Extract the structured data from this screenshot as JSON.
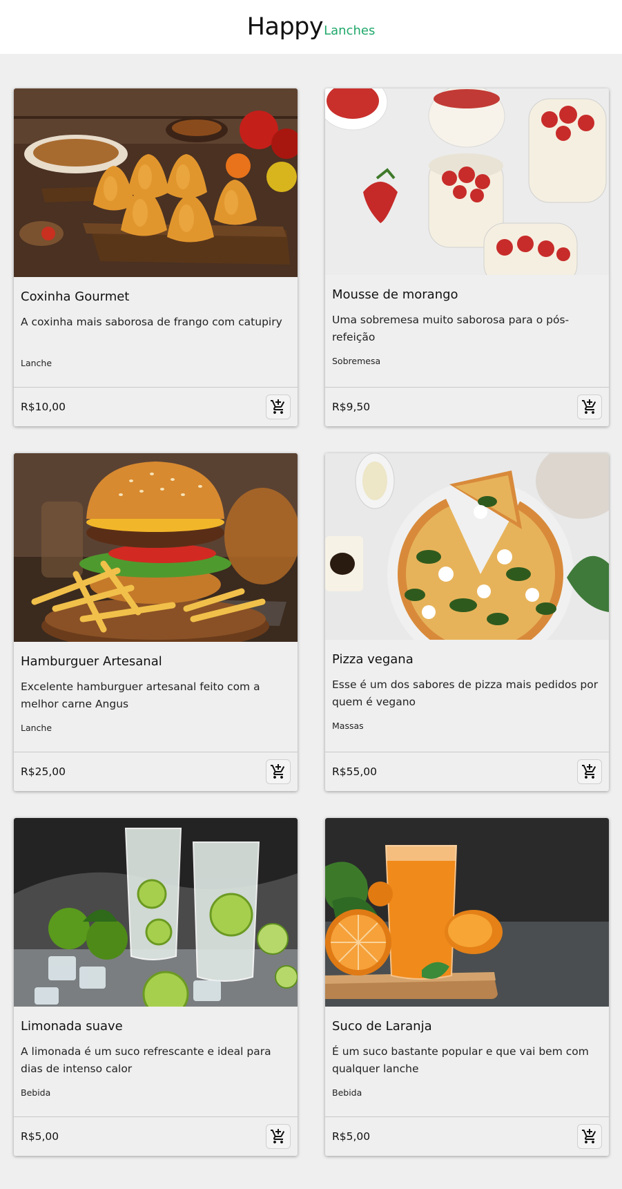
{
  "header": {
    "logo_main": "Happy",
    "logo_sub": "Lanches"
  },
  "colors": {
    "accent": "#1fa86a",
    "background": "#efefef",
    "header_bg": "#ffffff"
  },
  "products": [
    {
      "title": "Coxinha Gourmet",
      "description": "A coxinha mais saborosa de frango com catupiry",
      "category": "Lanche",
      "price": "R$10,00",
      "image": "coxinha-photo",
      "cart_icon": "add-to-cart-icon"
    },
    {
      "title": "Mousse de morango",
      "description": "Uma sobremesa muito saborosa para o pós-refeição",
      "category": "Sobremesa",
      "price": "R$9,50",
      "image": "mousse-photo",
      "cart_icon": "add-to-cart-icon"
    },
    {
      "title": "Hamburguer Artesanal",
      "description": "Excelente hamburguer artesanal feito com a melhor carne Angus",
      "category": "Lanche",
      "price": "R$25,00",
      "image": "burger-photo",
      "cart_icon": "add-to-cart-icon"
    },
    {
      "title": "Pizza vegana",
      "description": "Esse é um dos sabores de pizza mais pedidos por quem é vegano",
      "category": "Massas",
      "price": "R$55,00",
      "image": "pizza-photo",
      "cart_icon": "add-to-cart-icon"
    },
    {
      "title": "Limonada suave",
      "description": "A limonada é um suco refrescante e ideal para dias de intenso calor",
      "category": "Bebida",
      "price": "R$5,00",
      "image": "lemonade-photo",
      "cart_icon": "add-to-cart-icon"
    },
    {
      "title": "Suco de Laranja",
      "description": "É um suco bastante popular e que vai bem com qualquer lanche",
      "category": "Bebida",
      "price": "R$5,00",
      "image": "orange-juice-photo",
      "cart_icon": "add-to-cart-icon"
    }
  ]
}
